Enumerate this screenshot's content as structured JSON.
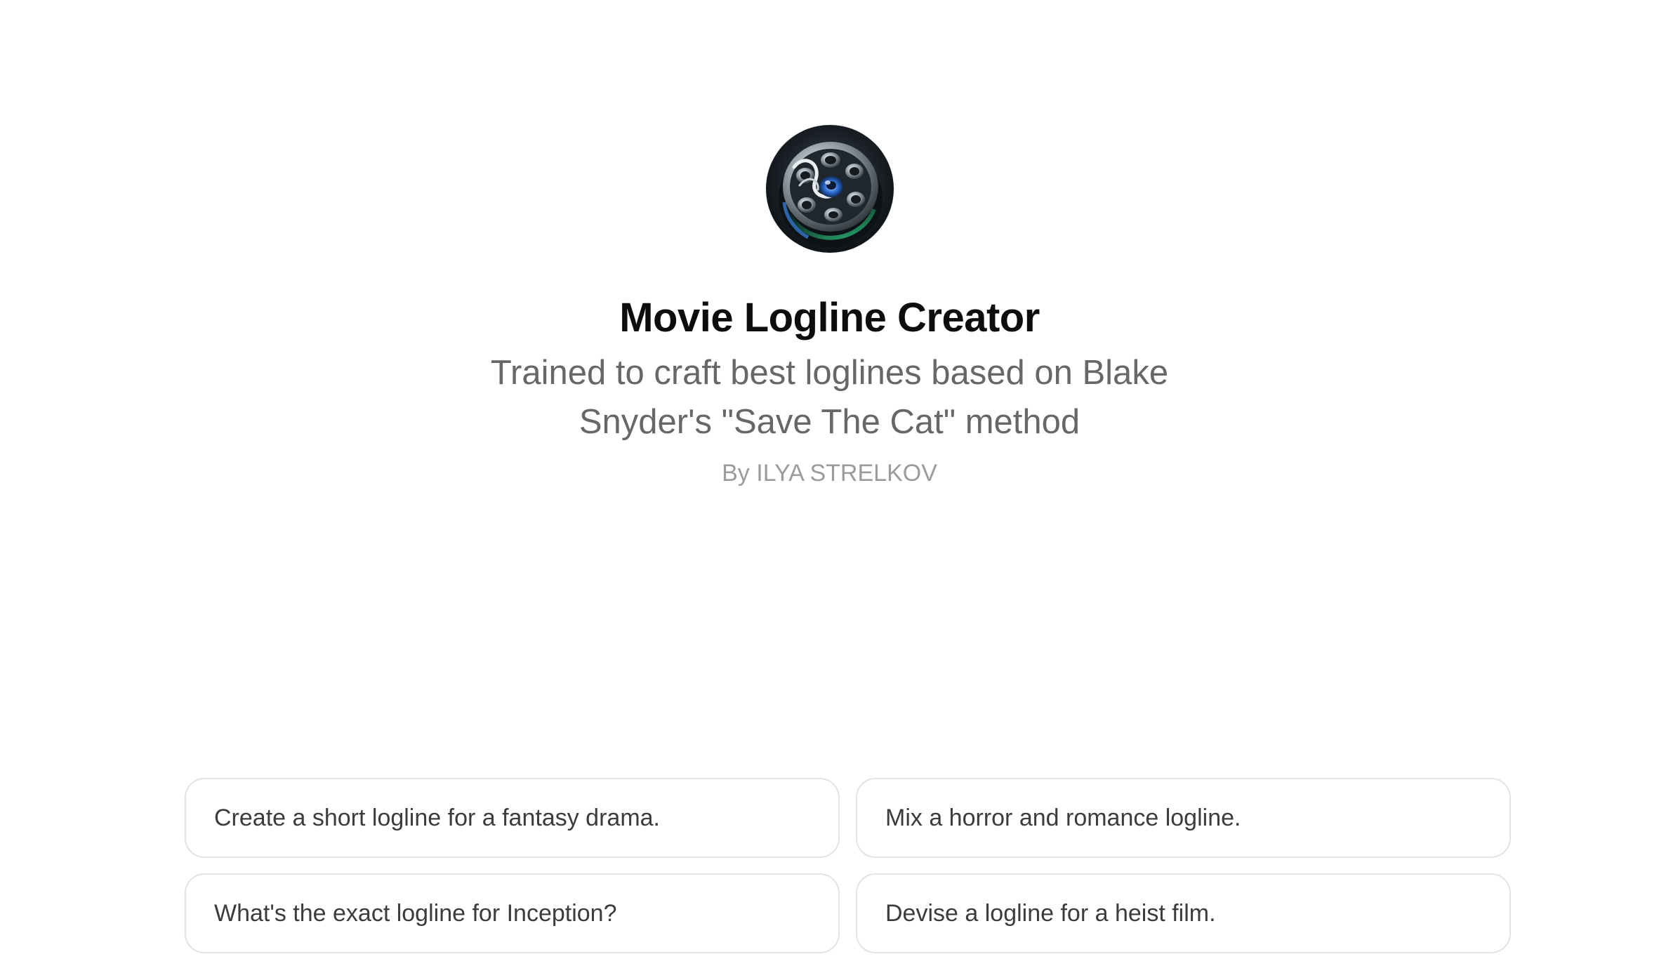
{
  "gpt": {
    "avatar_icon": "film-reel-icon",
    "name": "Movie Logline Creator",
    "description": "Trained to craft best loglines based on Blake Snyder's \"Save The Cat\" method",
    "author": "By ILYA STRELKOV"
  },
  "starters": [
    {
      "label": "Create a short logline for a fantasy drama."
    },
    {
      "label": "Mix a horror and romance logline."
    },
    {
      "label": "What's the exact logline for Inception?"
    },
    {
      "label": "Devise a logline for a heist film."
    }
  ],
  "colors": {
    "title": "#0d0d0d",
    "subtitle": "#676767",
    "byline": "#9b9b9b",
    "starter_text": "#3b3b40",
    "starter_border": "#e3e3e3"
  }
}
